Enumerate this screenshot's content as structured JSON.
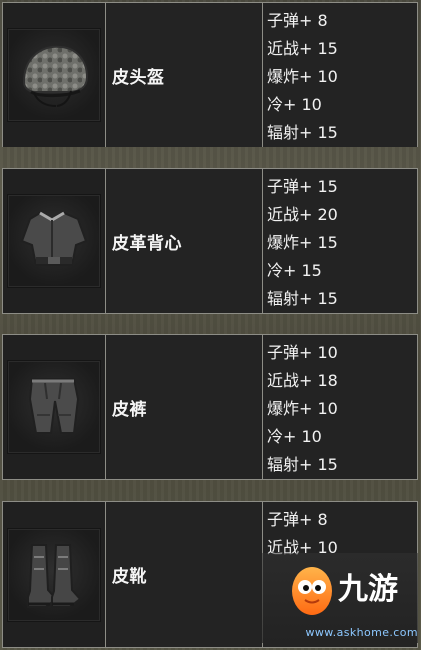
{
  "cards": [
    {
      "name": "皮头盔",
      "stats": [
        "子弹+ 8",
        "近战+ 15",
        "爆炸+ 10",
        "冷+ 10",
        "辐射+ 15"
      ]
    },
    {
      "name": "皮革背心",
      "stats": [
        "子弹+ 15",
        "近战+ 20",
        "爆炸+ 15",
        "冷+ 15",
        "辐射+ 15"
      ]
    },
    {
      "name": "皮裤",
      "stats": [
        "子弹+ 10",
        "近战+ 18",
        "爆炸+ 10",
        "冷+ 10",
        "辐射+ 15"
      ]
    },
    {
      "name": "皮靴",
      "stats": [
        "子弹+ 8",
        "近战+ 10"
      ]
    }
  ],
  "watermark": {
    "brand": "九游",
    "url": "www.askhome.com"
  }
}
